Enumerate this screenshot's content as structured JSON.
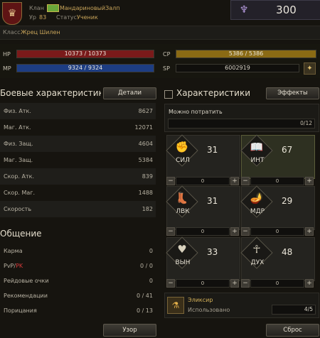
{
  "header": {
    "clan_label": "Клан",
    "clan_name": "МандариновыйЗалп",
    "level_label": "Ур",
    "level": "83",
    "status_label": "Статус",
    "status": "Ученик",
    "class_label": "Класс",
    "class_name": "Жрец Шилен",
    "gems": "300",
    "emblem_icon": "clan-crest-icon",
    "gem_icon": "gem-icon"
  },
  "bars": {
    "hp_label": "HP",
    "hp": "10373 / 10373",
    "mp_label": "MP",
    "mp": "9324 / 9324",
    "cp_label": "CP",
    "cp": "5386 / 5386",
    "sp_label": "SP",
    "sp": "6002919",
    "colors": {
      "hp": "#7a1a1a",
      "mp": "#1d3d82",
      "cp": "#8a6a14"
    }
  },
  "combat": {
    "title": "Боевые характеристики",
    "details_button": "Детали",
    "rows": [
      {
        "k": "Физ. Атк.",
        "v": "8627"
      },
      {
        "k": "Маг. Атк.",
        "v": "12071"
      },
      {
        "k": "Физ. Защ.",
        "v": "4604"
      },
      {
        "k": "Маг. Защ.",
        "v": "5384"
      },
      {
        "k": "Скор. Атк.",
        "v": "839"
      },
      {
        "k": "Скор. Маг.",
        "v": "1488"
      },
      {
        "k": "Скорость",
        "v": "182"
      }
    ]
  },
  "social": {
    "title": "Общение",
    "rows": [
      {
        "k": "Карма",
        "v": "0"
      },
      {
        "k_pvp": "PvP",
        "k_sep": "/",
        "k_pk": "PK",
        "v": "0 / 0"
      },
      {
        "k": "Рейдовые очки",
        "v": "0"
      },
      {
        "k": "Рекомендации",
        "v": "0 / 41"
      },
      {
        "k": "Порицания",
        "v": "0 / 13"
      }
    ],
    "pattern_button": "Узор"
  },
  "stats": {
    "title": "Характеристики",
    "effects_button": "Эффекты",
    "can_spend_label": "Можно потратить",
    "can_spend_value": "0/12",
    "cards": [
      {
        "abbr": "СИЛ",
        "value": "31",
        "step": "0",
        "icon": "arm-icon"
      },
      {
        "abbr": "ИНТ",
        "value": "67",
        "step": "0",
        "icon": "book-icon"
      },
      {
        "abbr": "ЛВК",
        "value": "31",
        "step": "0",
        "icon": "boot-icon"
      },
      {
        "abbr": "МДР",
        "value": "29",
        "step": "0",
        "icon": "lamp-icon"
      },
      {
        "abbr": "ВЫН",
        "value": "33",
        "step": "0",
        "icon": "heart-icon"
      },
      {
        "abbr": "ДУХ",
        "value": "48",
        "step": "0",
        "icon": "spirit-icon"
      }
    ],
    "elixir_label": "Эликсир",
    "elixir_used_label": "Использовано",
    "elixir_used": "4/5",
    "reset_button": "Сброс"
  }
}
